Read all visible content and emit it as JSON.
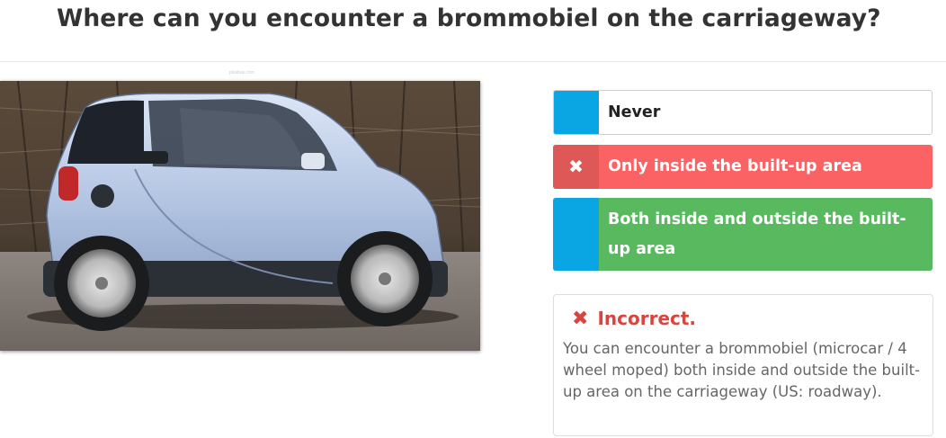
{
  "question": {
    "title": "Where can you encounter a brommobiel on the carriageway?",
    "image_credit": "pixabay.com"
  },
  "answers": [
    {
      "label": "Never",
      "marker": "",
      "state": "neutral"
    },
    {
      "label": "Only inside the built-up area",
      "marker": "✖",
      "state": "wrong-selected"
    },
    {
      "label": "Both inside and outside the built-up area",
      "marker": "",
      "state": "correct"
    }
  ],
  "feedback": {
    "icon": "x-icon",
    "title": "Incorrect.",
    "text": "You can encounter a brommobiel (microcar / 4 wheel moped) both inside and outside the built-up area on the carriageway (US: roadway)."
  },
  "colors": {
    "accent_blue": "#0aa5e3",
    "wrong_red": "#fa6263",
    "correct_green": "#58b95f",
    "feedback_red": "#d9443f"
  }
}
